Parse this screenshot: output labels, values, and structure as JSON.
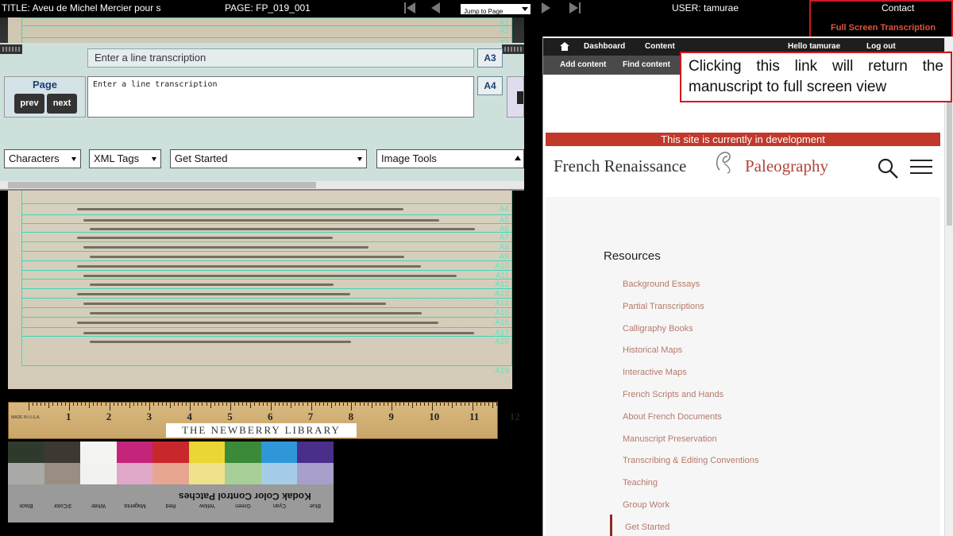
{
  "topbar": {
    "title": "TITLE: Aveu de Michel Mercier pour s",
    "page": "PAGE:  FP_019_001",
    "jump_to_page": "Jump to Page",
    "user": "USER:  tamurae",
    "contact": "Contact",
    "full_screen_link": "Full Screen Transcription"
  },
  "panel": {
    "line_placeholder": "Enter a line transcription",
    "line_tag_current": "A3",
    "line_tag_next": "A4",
    "page_label": "Page",
    "prev_label": "prev",
    "next_label": "next",
    "textarea_placeholder": "Enter a line transcription",
    "dropdowns": [
      "Characters",
      "XML Tags",
      "Get Started",
      "Image Tools"
    ]
  },
  "manuscript": {
    "line_labels": [
      "A1",
      "A2",
      "A3",
      "A4",
      "A5",
      "A6",
      "A7",
      "A8",
      "A9",
      "A10",
      "A11",
      "A12",
      "A13",
      "A14",
      "A15",
      "A16",
      "A17",
      "A18",
      "A19"
    ]
  },
  "ruler": {
    "numbers": [
      "1",
      "2",
      "3",
      "4",
      "5",
      "6",
      "7",
      "8",
      "9",
      "10",
      "11",
      "12"
    ],
    "label": "THE NEWBERRY LIBRARY",
    "made_in": "MADE IN U.S.A."
  },
  "color_card": {
    "patches_top": [
      "#2e3a2c",
      "#3e3832",
      "#f4f4f2",
      "#c4247a",
      "#c8282c",
      "#ecd634",
      "#3a8a3a",
      "#2f96d8",
      "#4a2f8a"
    ],
    "patches_bottom": [
      "#a9a9a7",
      "#9a8e84",
      "#f2f2f0",
      "#e0a8c8",
      "#e8a690",
      "#f0e28a",
      "#a8ce98",
      "#a6cde8",
      "#a89ecc"
    ],
    "labels": [
      "Black",
      "3/Color",
      "White",
      "Magenta",
      "Red",
      "Yellow",
      "Green",
      "Cyan",
      "Blue"
    ],
    "kodak": "Kodak Color Control Patches"
  },
  "site": {
    "admin_dashboard": "Dashboard",
    "admin_content": "Content",
    "admin_hello": "Hello ",
    "admin_user": "tamurae",
    "admin_logout": "Log out",
    "sub_add": "Add content",
    "sub_find": "Find content",
    "dev_banner": "This site is currently in development",
    "brand_left": "French Renaissance",
    "brand_right": "Paleography",
    "resources_title": "Resources",
    "resources": [
      "Background Essays",
      "Partial Transcriptions",
      "Calligraphy Books",
      "Historical Maps",
      "Interactive Maps",
      "French Scripts and Hands",
      "About French Documents",
      "Manuscript Preservation",
      "Transcribing & Editing Conventions",
      "Teaching",
      "Group Work",
      "Get Started"
    ]
  },
  "callout": {
    "text": "Clicking this link will return the manuscript to full screen view"
  },
  "colors": {
    "accent_red": "#d0191f",
    "line_box": "#3fd6b4",
    "banner": "#c0392b",
    "link_brown": "#b47a6a"
  }
}
